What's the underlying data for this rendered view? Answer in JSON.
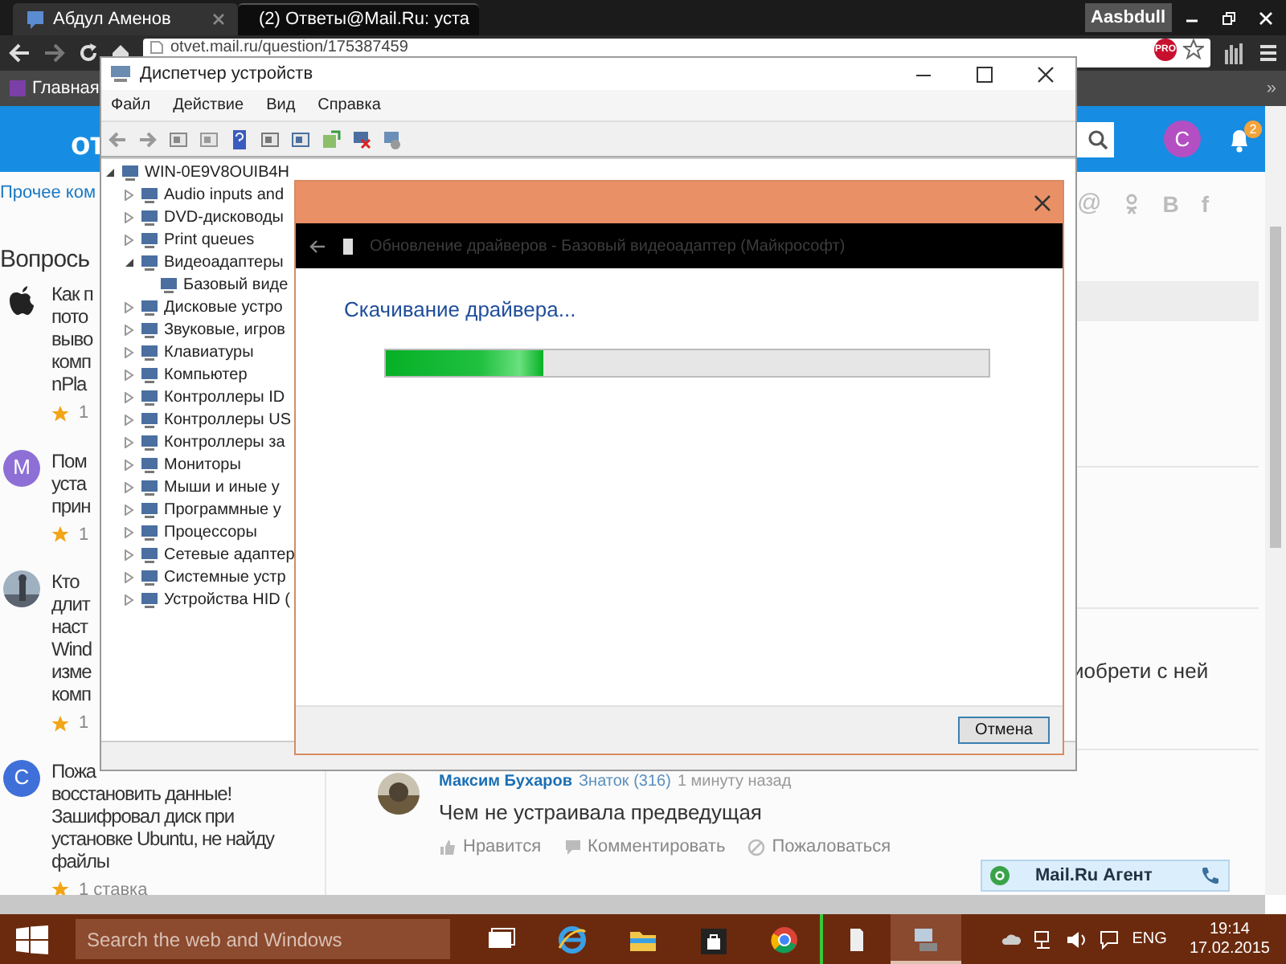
{
  "browser": {
    "tabs": [
      {
        "title": "Абдул Аменов",
        "selected": false
      },
      {
        "title": "(2) Ответы@Mail.Ru: уста",
        "selected": true
      }
    ],
    "profile": "Aasbdull",
    "address": "otvet.mail.ru/question/175387459",
    "pro_badge": "PRO",
    "bookmarks": [
      "Главная"
    ],
    "bookmarks_more": "»"
  },
  "page": {
    "logo": "от",
    "avatar": "C",
    "notifications": "2",
    "category": "Прочее ком",
    "section_title": "Вопрось",
    "questions": [
      {
        "avatar": {
          "kind": "icon"
        },
        "lines": [
          "Как п",
          "пото",
          "выво",
          "комп",
          "nPla"
        ],
        "rating": "1"
      },
      {
        "avatar": {
          "kind": "letter",
          "letter": "M",
          "color": "#8e6fd6"
        },
        "lines": [
          "Пом",
          "уста",
          "прин"
        ],
        "rating": "1"
      },
      {
        "lines": [
          "Кто",
          "длит",
          "наст",
          "Wind",
          "изме",
          "комп"
        ],
        "rating": "1"
      },
      {
        "avatar": {
          "kind": "letter",
          "letter": "C",
          "color": "#3f6fd8"
        },
        "lines": [
          "Пожа",
          "восстановить данные!",
          "Зашифровал диск при",
          "установке Ubuntu, не найду",
          "файлы"
        ],
        "rating": "1 ставка"
      }
    ],
    "social": [
      "@",
      "B",
      "f"
    ],
    "answer_fragment": "иобрети с ней",
    "comment": {
      "author": "Максим Бухаров",
      "rank": "Знаток (316)",
      "time": "1 минуту назад",
      "text": "Чем не устраивала предведущая",
      "actions": [
        "Нравится",
        "Комментировать",
        "Пожаловаться"
      ]
    },
    "agent": "Mail.Ru Агент"
  },
  "device_manager": {
    "title": "Диспетчер устройств",
    "menu": [
      "Файл",
      "Действие",
      "Вид",
      "Справка"
    ],
    "tree": {
      "label": "WIN-0E9V8OUIB4H",
      "expanded": true,
      "children": [
        {
          "label": "Audio inputs and",
          "expanded": false
        },
        {
          "label": "DVD-дисководы",
          "expanded": false
        },
        {
          "label": "Print queues",
          "expanded": false
        },
        {
          "label": "Видеоадаптеры",
          "expanded": true,
          "children": [
            {
              "label": "Базовый виде"
            }
          ]
        },
        {
          "label": "Дисковые устро",
          "expanded": false
        },
        {
          "label": "Звуковые, игров",
          "expanded": false
        },
        {
          "label": "Клавиатуры",
          "expanded": false
        },
        {
          "label": "Компьютер",
          "expanded": false
        },
        {
          "label": "Контроллеры ID",
          "expanded": false
        },
        {
          "label": "Контроллеры US",
          "expanded": false
        },
        {
          "label": "Контроллеры за",
          "expanded": false
        },
        {
          "label": "Мониторы",
          "expanded": false
        },
        {
          "label": "Мыши и иные у",
          "expanded": false
        },
        {
          "label": "Программные у",
          "expanded": false
        },
        {
          "label": "Процессоры",
          "expanded": false
        },
        {
          "label": "Сетевые адаптер",
          "expanded": false
        },
        {
          "label": "Системные устр",
          "expanded": false
        },
        {
          "label": "Устройства HID (",
          "expanded": false
        }
      ]
    }
  },
  "dialog": {
    "title": "Обновление драйверов - Базовый видеоадаптер (Майкрософт)",
    "heading": "Скачивание драйвера...",
    "progress": {
      "level": 0.26
    },
    "cancel": "Отмена"
  },
  "taskbar": {
    "search_placeholder": "Search the web and Windows",
    "language": "ENG",
    "time": "19:14",
    "date": "17.02.2015"
  }
}
